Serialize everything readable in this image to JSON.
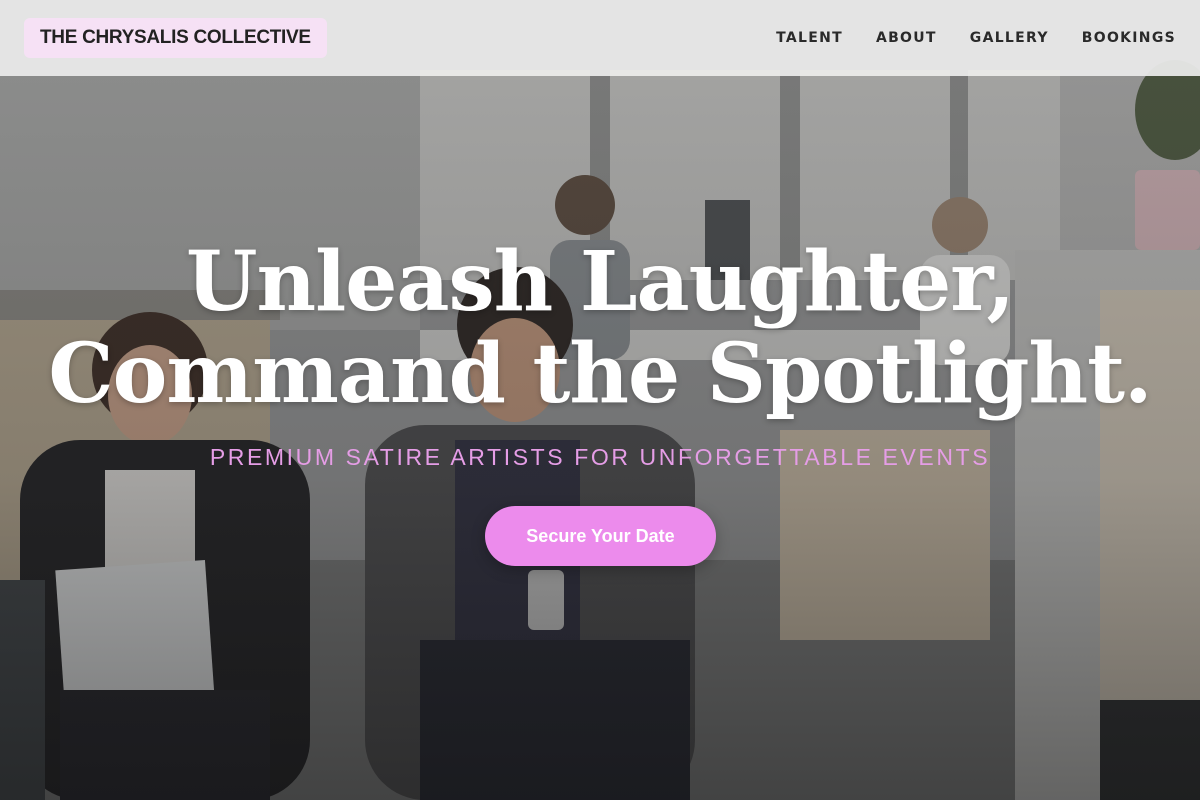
{
  "brand": {
    "logo_text": "THE CHRYSALIS COLLECTIVE",
    "logo_bg": "#f6e1f5"
  },
  "nav": {
    "items": [
      {
        "label": "TALENT"
      },
      {
        "label": "ABOUT"
      },
      {
        "label": "GALLERY"
      },
      {
        "label": "BOOKINGS"
      }
    ]
  },
  "hero": {
    "headline_line1": "Unleash Laughter,",
    "headline_line2": "Command the Spotlight.",
    "subheadline": "PREMIUM SATIRE ARTISTS FOR UNFORGETTABLE EVENTS",
    "cta_label": "Secure Your Date",
    "accent_color": "#ec8bec",
    "background_image": "office-scene-people-waiting"
  }
}
